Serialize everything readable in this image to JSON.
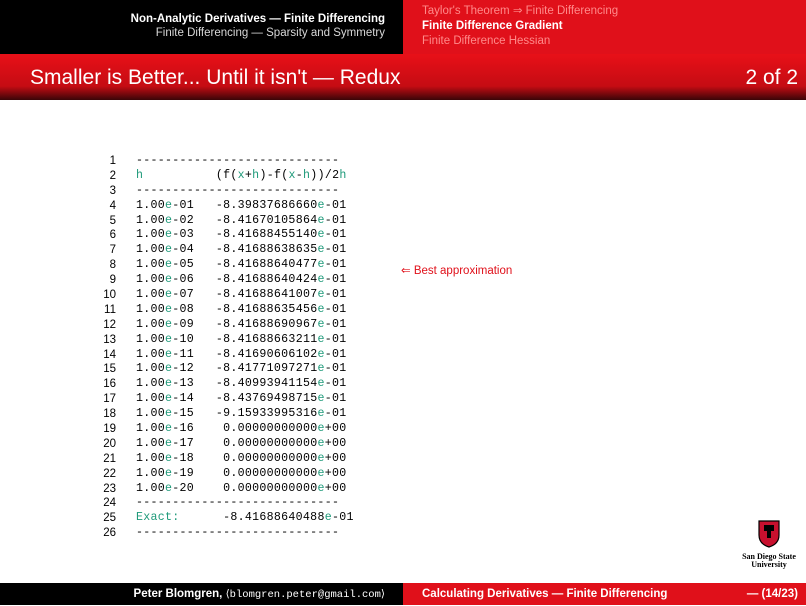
{
  "nav": {
    "section_title": "Non-Analytic Derivatives — Finite Differencing",
    "subsection_title": "Finite Differencing — Sparsity and Symmetry",
    "items": [
      "Taylor's Theorem ⇒ Finite Differencing",
      "Finite Difference Gradient",
      "Finite Difference Hessian"
    ],
    "current_index": 1
  },
  "frame": {
    "title": "Smaller is Better... Until it isn't — Redux",
    "page": "2 of 2"
  },
  "listing": {
    "header_h": "h",
    "header_formula": "(f(x+h)-f(x-h))/2h",
    "rows": [
      {
        "h": "1.00e-01",
        "v": "-8.39837686660e-01"
      },
      {
        "h": "1.00e-02",
        "v": "-8.41670105864e-01"
      },
      {
        "h": "1.00e-03",
        "v": "-8.41688455140e-01"
      },
      {
        "h": "1.00e-04",
        "v": "-8.41688638635e-01"
      },
      {
        "h": "1.00e-05",
        "v": "-8.41688640477e-01"
      },
      {
        "h": "1.00e-06",
        "v": "-8.41688640424e-01"
      },
      {
        "h": "1.00e-07",
        "v": "-8.41688641007e-01"
      },
      {
        "h": "1.00e-08",
        "v": "-8.41688635456e-01"
      },
      {
        "h": "1.00e-09",
        "v": "-8.41688690967e-01"
      },
      {
        "h": "1.00e-10",
        "v": "-8.41688663211e-01"
      },
      {
        "h": "1.00e-11",
        "v": "-8.41690606102e-01"
      },
      {
        "h": "1.00e-12",
        "v": "-8.41771097271e-01"
      },
      {
        "h": "1.00e-13",
        "v": "-8.40993941154e-01"
      },
      {
        "h": "1.00e-14",
        "v": "-8.43769498715e-01"
      },
      {
        "h": "1.00e-15",
        "v": "-9.15933995316e-01"
      },
      {
        "h": "1.00e-16",
        "v": " 0.00000000000e+00"
      },
      {
        "h": "1.00e-17",
        "v": " 0.00000000000e+00"
      },
      {
        "h": "1.00e-18",
        "v": " 0.00000000000e+00"
      },
      {
        "h": "1.00e-19",
        "v": " 0.00000000000e+00"
      },
      {
        "h": "1.00e-20",
        "v": " 0.00000000000e+00"
      }
    ],
    "exact_label": "Exact:",
    "exact_value": "-8.41688640488e-01",
    "note": "⇐ Best approximation"
  },
  "logo": {
    "text": "San Diego State University"
  },
  "footer": {
    "author": "Peter Blomgren,",
    "email": "⟨blomgren.peter@gmail.com⟩",
    "title": "Calculating Derivatives — Finite Differencing",
    "page": "— (14/23)"
  },
  "colors": {
    "accent": "#e0101a",
    "keyword": "#1f9a7a"
  }
}
